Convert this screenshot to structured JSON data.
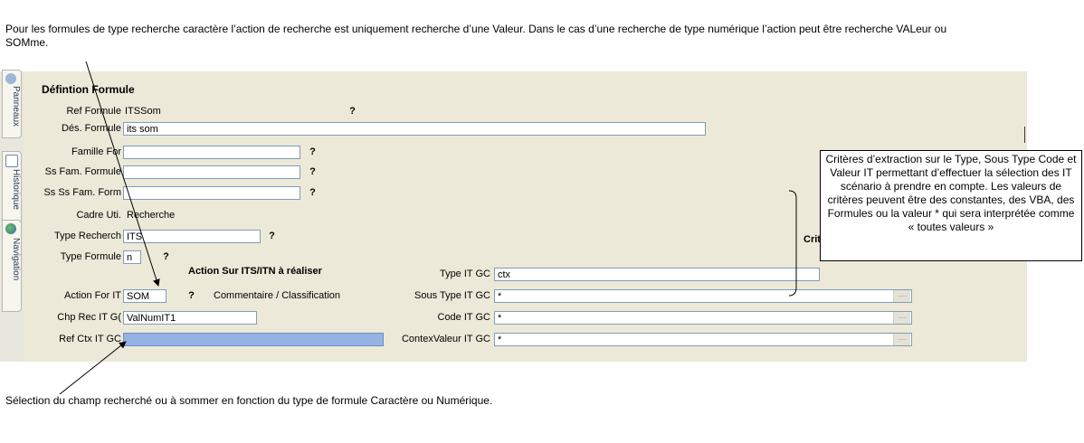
{
  "intro_text": "Pour les formules de type recherche caractère l’action de recherche est uniquement recherche d’une Valeur. Dans le cas d’une recherche de type numérique l’action peut être recherche VALeur ou SOMme.",
  "bottom_caption": "Sélection du champ recherché ou à sommer en fonction du type de formule Caractère ou Numérique.",
  "callout_text": "Critères d’extraction  sur le Type, Sous Type Code et Valeur IT permettant d’effectuer la sélection des IT scénario à prendre en compte. Les valeurs de critères peuvent être des constantes, des VBA, des Formules ou la valeur * qui sera interprétée comme « toutes valeurs »",
  "side_tabs": [
    "Panneaux",
    "Historique",
    "Navigation"
  ],
  "form": {
    "section_title": "Défintion Formule",
    "help_button": "?",
    "ref_formule": {
      "label": "Ref Formule",
      "value": "ITSSom"
    },
    "des_formule": {
      "label": "Dés. Formule",
      "value": "its som"
    },
    "famille_for": {
      "label": "Famille For",
      "value": ""
    },
    "ss_fam_formule": {
      "label": "Ss Fam. Formule",
      "value": ""
    },
    "ss_ss_fam_form": {
      "label": "Ss Ss Fam. Form",
      "value": ""
    },
    "cadre_uti": {
      "label": "Cadre Uti.",
      "value": "Recherche"
    },
    "type_recherch": {
      "label": "Type Recherch",
      "value": "ITS"
    },
    "type_formule": {
      "label": "Type Formule",
      "value": "n"
    },
    "action_header": "Action Sur ITS/ITN à réaliser",
    "action_for_it": {
      "label": "Action For IT",
      "value": "SOM"
    },
    "commentaire_label": "Commentaire / Classification",
    "chp_rec_it": {
      "label": "Chp Rec IT G(",
      "value": "ValNumIT1"
    },
    "ref_ctx_it": {
      "label": "Ref Ctx IT GC",
      "value": ""
    },
    "criteres_header": "Criteres de recherc",
    "type_it_gc": {
      "label": "Type IT GC",
      "value": "ctx"
    },
    "sous_type_it_gc": {
      "label": "Sous Type IT GC",
      "value": "*"
    },
    "code_it_gc": {
      "label": "Code IT GC",
      "value": "*"
    },
    "contex_valeur_it_gc": {
      "label": "ContexValeur IT GC",
      "value": "*"
    }
  },
  "colors": {
    "panel_bg": "#ece9d8",
    "field_border": "#7f9db9",
    "selected_field": "#94b2e2"
  }
}
